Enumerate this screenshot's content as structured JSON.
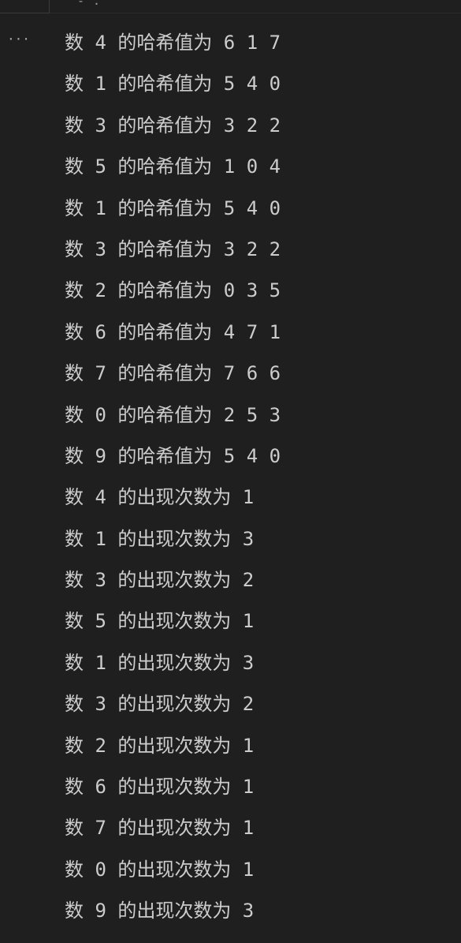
{
  "header": {
    "clipped_text": "- ."
  },
  "gutter": {
    "ellipsis": "···"
  },
  "output": {
    "lines": [
      "数 4 的哈希值为 6 1 7",
      "数 1 的哈希值为 5 4 0",
      "数 3 的哈希值为 3 2 2",
      "数 5 的哈希值为 1 0 4",
      "数 1 的哈希值为 5 4 0",
      "数 3 的哈希值为 3 2 2",
      "数 2 的哈希值为 0 3 5",
      "数 6 的哈希值为 4 7 1",
      "数 7 的哈希值为 7 6 6",
      "数 0 的哈希值为 2 5 3",
      "数 9 的哈希值为 5 4 0",
      "数 4 的出现次数为 1",
      "数 1 的出现次数为 3",
      "数 3 的出现次数为 2",
      "数 5 的出现次数为 1",
      "数 1 的出现次数为 3",
      "数 3 的出现次数为 2",
      "数 2 的出现次数为 1",
      "数 6 的出现次数为 1",
      "数 7 的出现次数为 1",
      "数 0 的出现次数为 1",
      "数 9 的出现次数为 3"
    ]
  }
}
